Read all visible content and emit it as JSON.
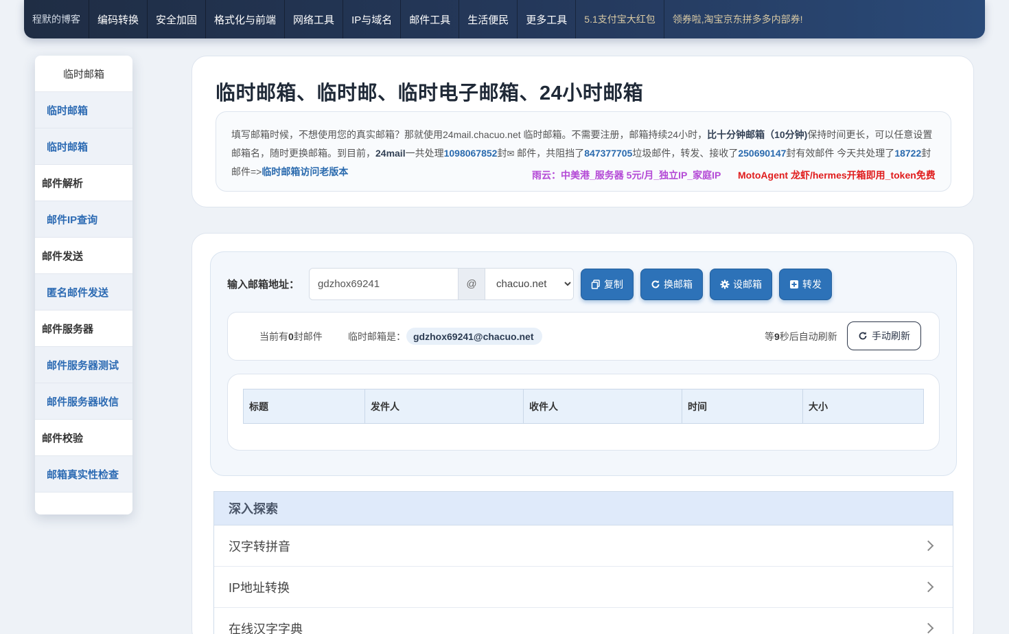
{
  "nav": {
    "items": [
      {
        "label": "程默的博客",
        "kind": "blog"
      },
      {
        "label": "编码转换",
        "kind": "normal"
      },
      {
        "label": "安全加固",
        "kind": "normal"
      },
      {
        "label": "格式化与前端",
        "kind": "normal"
      },
      {
        "label": "网络工具",
        "kind": "normal"
      },
      {
        "label": "IP与域名",
        "kind": "normal"
      },
      {
        "label": "邮件工具",
        "kind": "normal"
      },
      {
        "label": "生活便民",
        "kind": "normal"
      },
      {
        "label": "更多工具",
        "kind": "normal"
      },
      {
        "label": "5.1支付宝大红包",
        "kind": "promo"
      },
      {
        "label": "领券啦,淘宝京东拼多多内部券!",
        "kind": "promo"
      }
    ]
  },
  "sidebar": {
    "title": "临时邮箱",
    "items": [
      {
        "label": "临时邮箱",
        "type": "link"
      },
      {
        "label": "临时邮箱",
        "type": "link"
      },
      {
        "label": "邮件解析",
        "type": "head"
      },
      {
        "label": "邮件IP查询",
        "type": "link"
      },
      {
        "label": "邮件发送",
        "type": "head"
      },
      {
        "label": "匿名邮件发送",
        "type": "link"
      },
      {
        "label": "邮件服务器",
        "type": "head"
      },
      {
        "label": "邮件服务器测试",
        "type": "link"
      },
      {
        "label": "邮件服务器收信",
        "type": "link"
      },
      {
        "label": "邮件校验",
        "type": "head"
      },
      {
        "label": "邮箱真实性检查",
        "type": "link"
      }
    ]
  },
  "header": {
    "title": "临时邮箱、临时邮、临时电子邮箱、24小时邮箱"
  },
  "info": {
    "p1": "填写邮箱时候，不想使用您的真实邮箱？那就使用24mail.chacuo.net 临时邮箱。不需要注册，邮箱持续24小时，",
    "p1_bold": "比十分钟邮箱（10分钟)",
    "p2": "保持时间更长，可以任意设置邮箱名，随时更换邮箱。到目前，",
    "brand": "24mail",
    "p3": "一共处理",
    "total": "1098067852",
    "p4": "封",
    "mail_word": "邮件",
    "p5": "，共阻挡了",
    "blocked": "847377705",
    "p6": "垃圾邮件，转发、接收了",
    "received": "250690147",
    "p7": "封有效邮件 今天共处理了",
    "today": "18722",
    "p8": "封邮件=>",
    "old_link": "临时邮箱访问老版本",
    "ad1": "雨云：中美港_服务器 5元/月_独立IP_家庭IP",
    "ad2": "MotoAgent 龙虾/hermes开箱即用_token免费"
  },
  "mailbox": {
    "label": "输入邮箱地址：",
    "name_value": "gdzhox69241",
    "at": "@",
    "domain_selected": "chacuo.net",
    "buttons": {
      "copy": "复制",
      "change": "换邮箱",
      "set": "设邮箱",
      "forward": "转发"
    },
    "status_prefix": "当前有",
    "count": "0",
    "status_suffix": "封邮件",
    "addr_label": "临时邮箱是：",
    "full_address": "gdzhox69241@chacuo.net",
    "wait_prefix": "等",
    "seconds": "9",
    "wait_suffix": "秒后自动刷新",
    "refresh_label": "手动刷新"
  },
  "table": {
    "columns": [
      "标题",
      "发件人",
      "收件人",
      "时间",
      "大小"
    ]
  },
  "explore": {
    "title": "深入探索",
    "items": [
      "汉字转拼音",
      "IP地址转换",
      "在线汉字字典"
    ]
  }
}
